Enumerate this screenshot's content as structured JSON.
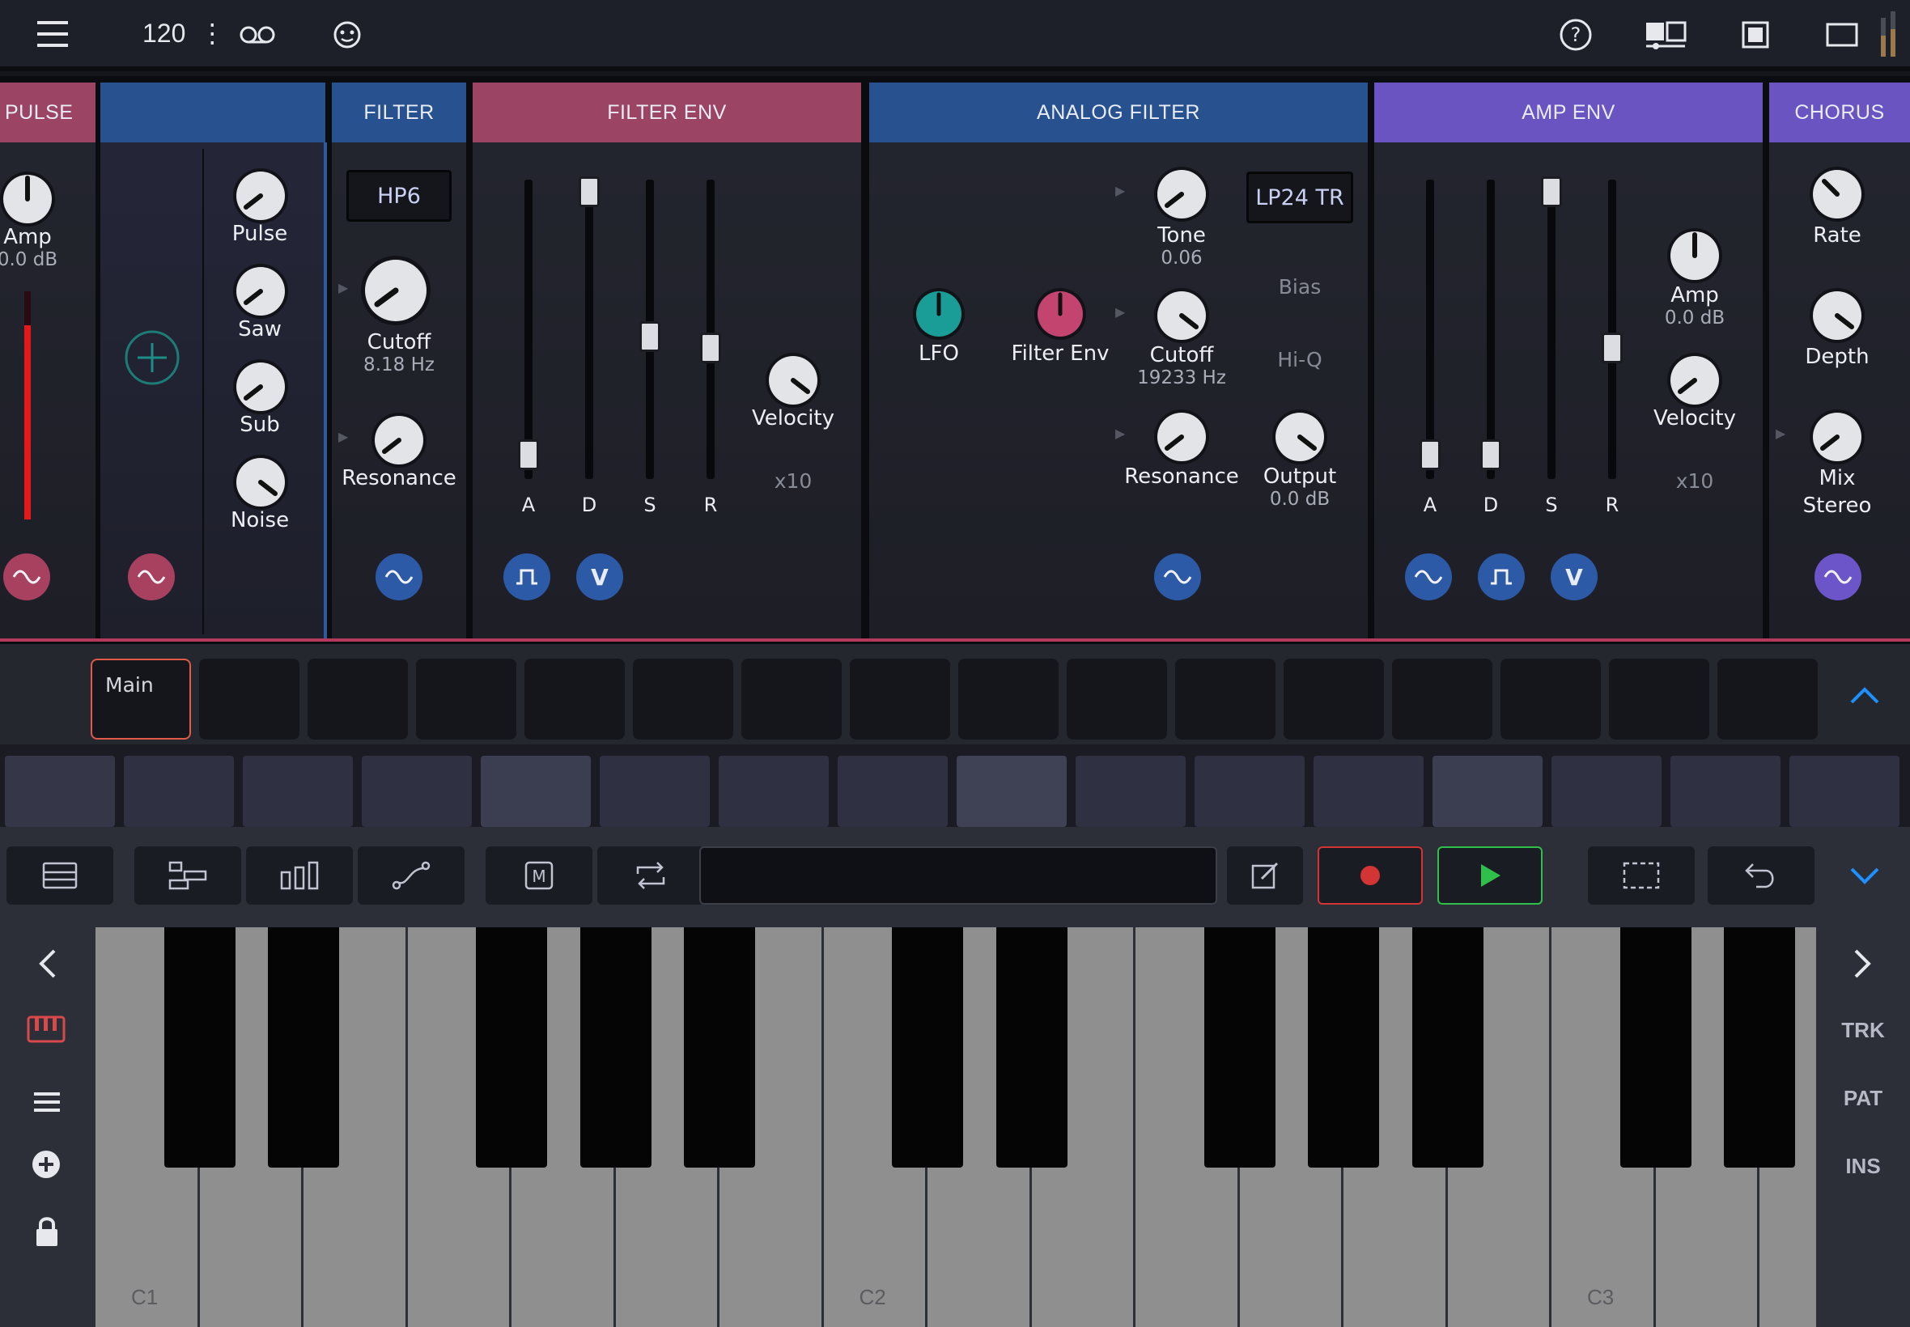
{
  "topbar": {
    "tempo": "120",
    "tempo_menu": "⋮",
    "icons": [
      "menu-icon",
      "tape-loop-icon",
      "smiley-icon",
      "help-icon",
      "split-view-icon",
      "window-icon",
      "fullscreen-icon",
      "level-meter-icon"
    ]
  },
  "panels": {
    "pulse": {
      "title": "PULSE",
      "amp_label": "Amp",
      "amp_value": "0.0 dB",
      "level": 0.85
    },
    "osc": {
      "title": "",
      "knobs": [
        "Pulse",
        "Saw",
        "Sub",
        "Noise"
      ]
    },
    "filter": {
      "title": "FILTER",
      "mode": "HP6",
      "cutoff_label": "Cutoff",
      "cutoff_value": "8.18 Hz",
      "resonance_label": "Resonance"
    },
    "filter_env": {
      "title": "FILTER ENV",
      "sliders": [
        "A",
        "D",
        "S",
        "R"
      ],
      "levels": [
        0.02,
        1.0,
        0.46,
        0.42
      ],
      "velocity_label": "Velocity",
      "multiplier": "x10",
      "mod_v": "V"
    },
    "analog_filter": {
      "title": "ANALOG FILTER",
      "lfo_label": "LFO",
      "filter_env_label": "Filter Env",
      "tone_label": "Tone",
      "tone_value": "0.06",
      "cutoff_label": "Cutoff",
      "cutoff_value": "19233 Hz",
      "resonance_label": "Resonance",
      "mode": "LP24 TR",
      "bias_label": "Bias",
      "hiq_label": "Hi-Q",
      "output_label": "Output",
      "output_value": "0.0 dB"
    },
    "amp_env": {
      "title": "AMP ENV",
      "sliders": [
        "A",
        "D",
        "S",
        "R"
      ],
      "levels": [
        0.02,
        0.02,
        1.0,
        0.42
      ],
      "amp_label": "Amp",
      "amp_value": "0.0 dB",
      "velocity_label": "Velocity",
      "multiplier": "x10",
      "mod_v": "V"
    },
    "chorus": {
      "title": "CHORUS",
      "rate_label": "Rate",
      "depth_label": "Depth",
      "mix_label": "Mix",
      "stereo_label": "Stereo"
    }
  },
  "patterns": {
    "first_label": "Main",
    "count": 16
  },
  "right_nav": {
    "trk": "TRK",
    "pat": "PAT",
    "ins": "INS"
  },
  "keyboard": {
    "octaves": [
      "C1",
      "C2",
      "C3"
    ]
  },
  "colors": {
    "pink": "#9b4463",
    "blue": "#28528f",
    "purple": "#6a54c2",
    "record": "#d33434",
    "play": "#2fbf4a",
    "accent": "#1e90ff"
  }
}
